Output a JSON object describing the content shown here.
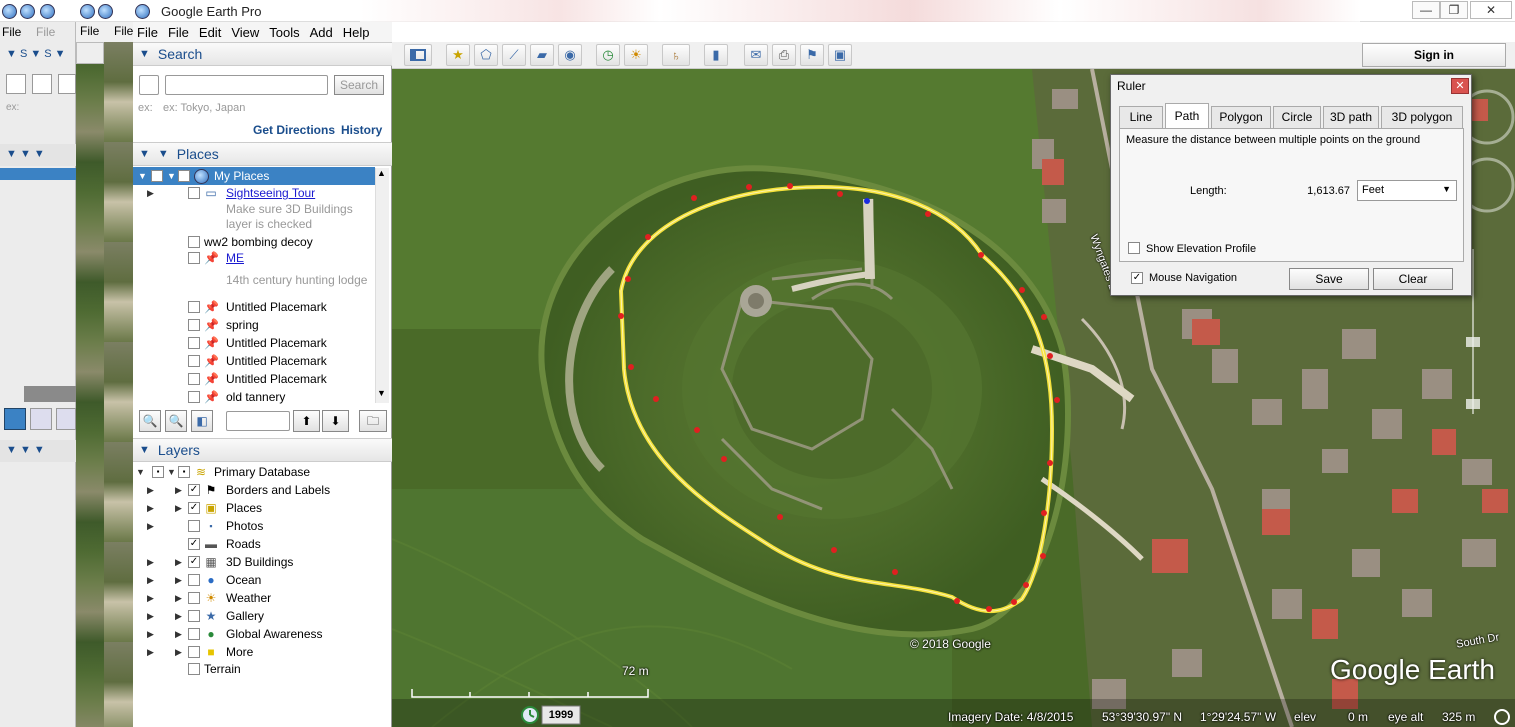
{
  "window": {
    "title": "Google Earth Pro",
    "min": "—",
    "max": "❐",
    "close": "✕"
  },
  "menu": {
    "items": [
      "File",
      "Edit",
      "View",
      "Tools",
      "Add",
      "Help"
    ],
    "ghost_items": [
      "File",
      "File",
      "File",
      "File"
    ]
  },
  "toolbar": {
    "signin": "Sign in"
  },
  "search": {
    "title": "Search",
    "button": "Search",
    "example": "ex: Tokyo, Japan",
    "ghost_example": "ex:",
    "get_directions": "Get Directions",
    "history": "History"
  },
  "places": {
    "title": "Places",
    "items": [
      {
        "label": "My Places"
      },
      {
        "label": "Sightseeing Tour"
      },
      {
        "label": "Make sure 3D Buildings"
      },
      {
        "label": "layer is checked"
      },
      {
        "label": "ww2 bombing decoy"
      },
      {
        "label": "ME"
      },
      {
        "label": "14th century hunting lodge"
      },
      {
        "label": "Untitled Placemark"
      },
      {
        "label": "spring"
      },
      {
        "label": "Untitled Placemark"
      },
      {
        "label": "Untitled Placemark"
      },
      {
        "label": "Untitled Placemark"
      },
      {
        "label": "old tannery"
      }
    ]
  },
  "layers": {
    "title": "Layers",
    "items": [
      {
        "label": "Primary Database"
      },
      {
        "label": "Borders and Labels"
      },
      {
        "label": "Places"
      },
      {
        "label": "Photos"
      },
      {
        "label": "Roads"
      },
      {
        "label": "3D Buildings"
      },
      {
        "label": "Ocean"
      },
      {
        "label": "Weather"
      },
      {
        "label": "Gallery"
      },
      {
        "label": "Global Awareness"
      },
      {
        "label": "More"
      },
      {
        "label": "Terrain"
      }
    ]
  },
  "ruler": {
    "title": "Ruler",
    "tabs": [
      "Line",
      "Path",
      "Polygon",
      "Circle",
      "3D path",
      "3D polygon"
    ],
    "description": "Measure the distance between multiple points on the ground",
    "length_label": "Length:",
    "length_value": "1,613.67",
    "unit": "Feet",
    "show_elevation": "Show Elevation Profile",
    "mouse_nav": "Mouse Navigation",
    "save": "Save",
    "clear": "Clear"
  },
  "map": {
    "copyright": "© 2018 Google",
    "scale": "72 m",
    "brand": "Google Earth",
    "road_label": "Wyngates Ln",
    "road_label2": "South Dr",
    "year": "1999",
    "imagery_date": "Imagery Date: 4/8/2015",
    "lat": "53°39'30.97\" N",
    "lon": "1°29'24.57\" W",
    "elev_label": "elev",
    "elev": "0 m",
    "eye_label": "eye alt",
    "eye": "325 m"
  },
  "colors": {
    "path": "#f5e23a",
    "marker": "#e02020",
    "accent": "#1a4d8c",
    "selection": "#3b82c4"
  }
}
